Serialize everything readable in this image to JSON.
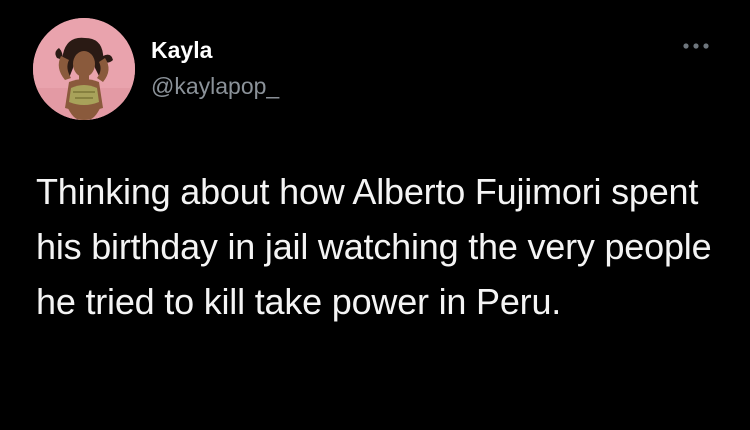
{
  "author": {
    "display_name": "Kayla",
    "handle": "@kaylapop_",
    "avatar_icon": "profile-photo"
  },
  "menu": {
    "icon": "more-dots-icon"
  },
  "tweet": {
    "text": "Thinking about how Alberto Fujimori spent his birthday in jail watching the very people he tried to kill take power in Peru."
  },
  "colors": {
    "background": "#000000",
    "primary_text": "#ffffff",
    "secondary_text": "#8b9299",
    "avatar_bg": "#e9a3ad"
  }
}
